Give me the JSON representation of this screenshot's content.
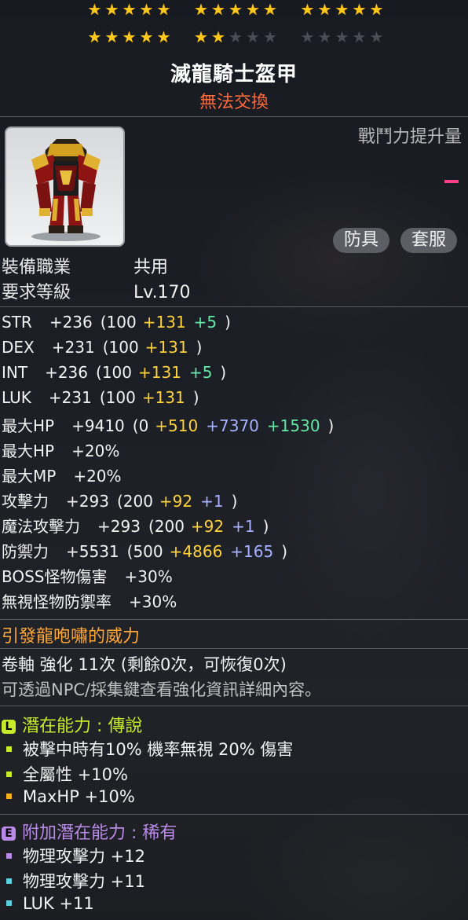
{
  "stars": {
    "row1": [
      "on",
      "on",
      "on",
      "on",
      "on",
      "on",
      "on",
      "on",
      "on",
      "on",
      "on",
      "on",
      "on",
      "on",
      "on"
    ],
    "row2": [
      "on",
      "on",
      "on",
      "on",
      "on",
      "on",
      "on",
      "off",
      "off",
      "off",
      "off",
      "off",
      "off",
      "off",
      "off"
    ],
    "star_glyph": "★"
  },
  "item": {
    "name": "滅龍騎士盔甲",
    "trade_status": "無法交換",
    "power_label": "戰鬥力提升量",
    "tags": [
      "防具",
      "套服"
    ]
  },
  "requirements": {
    "job_label": "裝備職業",
    "job_value": "共用",
    "level_label": "要求等級",
    "level_value": "Lv.170"
  },
  "stats": [
    {
      "name": "STR",
      "total": "+236",
      "base": "(100",
      "bonus": "+131",
      "star": "+5",
      "close": ")"
    },
    {
      "name": "DEX",
      "total": "+231",
      "base": "(100",
      "bonus": "+131",
      "close": ")"
    },
    {
      "name": "INT",
      "total": "+236",
      "base": "(100",
      "bonus": "+131",
      "star": "+5",
      "close": ")"
    },
    {
      "name": "LUK",
      "total": "+231",
      "base": "(100",
      "bonus": "+131",
      "close": ")"
    },
    {
      "name": "最大HP",
      "total": "+9410",
      "base": "(0",
      "bonus": "+510",
      "upgrade": "+7370",
      "star": "+1530",
      "close": ")"
    },
    {
      "name": "最大HP",
      "total": "+20%"
    },
    {
      "name": "最大MP",
      "total": "+20%"
    },
    {
      "name": "攻擊力",
      "total": "+293",
      "base": "(200",
      "bonus": "+92",
      "upgrade": "+1",
      "close": ")"
    },
    {
      "name": "魔法攻擊力",
      "total": "+293",
      "base": "(200",
      "bonus": "+92",
      "upgrade": "+1",
      "close": ")"
    },
    {
      "name": "防禦力",
      "total": "+5531",
      "base": "(500",
      "bonus": "+4866",
      "upgrade": "+165",
      "close": ")"
    },
    {
      "name": "BOSS怪物傷害",
      "total": "+30%"
    },
    {
      "name": "無視怪物防禦率",
      "total": "+30%"
    }
  ],
  "set_effect": "引發龍咆嘯的威力",
  "enhance": {
    "text": "卷軸 強化 11次 (剩餘0次，可恢復0次)",
    "hint": "可透過NPC/採集鍵查看強化資訊詳細內容。"
  },
  "potential": {
    "badge": "L",
    "header": "潛在能力 : 傳說",
    "badge_color": "#c8ea2a",
    "lines": [
      {
        "text": "被擊中時有10% 機率無視 20% 傷害",
        "bullet_color": "#c8ea2a"
      },
      {
        "text": "全屬性 +10%",
        "bullet_color": "#c8ea2a"
      },
      {
        "text": "MaxHP +10%",
        "bullet_color": "#ffb21c"
      }
    ]
  },
  "additional_potential": {
    "badge": "E",
    "header": "附加潛在能力 : 稀有",
    "badge_color": "#b98ae8",
    "lines": [
      {
        "text": "物理攻擊力 +12",
        "bullet_color": "#b98ae8"
      },
      {
        "text": "物理攻擊力 +11",
        "bullet_color": "#58d0e0"
      },
      {
        "text": "LUK +11",
        "bullet_color": "#58d0e0"
      }
    ]
  }
}
